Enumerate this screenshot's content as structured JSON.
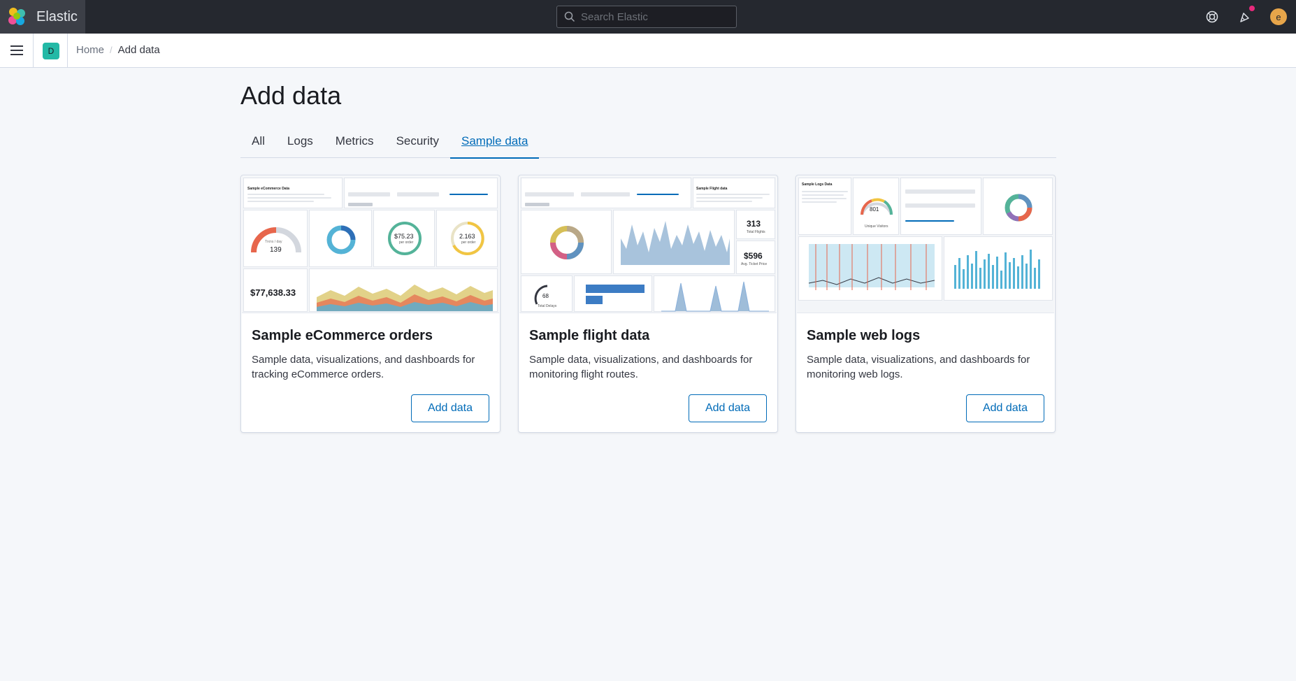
{
  "header": {
    "brand": "Elastic",
    "search_placeholder": "Search Elastic",
    "avatar_initial": "e",
    "icons": [
      "elastic-logo-icon",
      "search-icon",
      "help-icon",
      "newsfeed-icon"
    ]
  },
  "subheader": {
    "space_initial": "D",
    "breadcrumbs": [
      "Home",
      "Add data"
    ]
  },
  "main": {
    "title": "Add data",
    "tabs": [
      "All",
      "Logs",
      "Metrics",
      "Security",
      "Sample data"
    ],
    "active_tab": "Sample data",
    "cards": [
      {
        "title": "Sample eCommerce orders",
        "description": "Sample data, visualizations, and dashboards for tracking eCommerce orders.",
        "button": "Add data",
        "thumb": {
          "markdown_title": "Sample eCommerce Data",
          "gauge_label": "Trxns / day",
          "gauge_value": "139",
          "avg_price": "$75.23",
          "avg_price_sub": "per order",
          "avg_items": "2.163",
          "avg_items_sub": "per order",
          "total_revenue": "$77,638.33"
        }
      },
      {
        "title": "Sample flight data",
        "description": "Sample data, visualizations, and dashboards for monitoring flight routes.",
        "button": "Add data",
        "thumb": {
          "markdown_title": "Sample Flight data",
          "total_flights": "313",
          "total_flights_label": "Total Flights",
          "avg_ticket": "$596",
          "avg_ticket_label": "Avg. Ticket Price",
          "delays": "68",
          "delays_label": "Total Delays"
        }
      },
      {
        "title": "Sample web logs",
        "description": "Sample data, visualizations, and dashboards for monitoring web logs.",
        "button": "Add data",
        "thumb": {
          "markdown_title": "Sample Logs Data",
          "visitors": "801",
          "visitors_label": "Unique Visitors"
        }
      }
    ]
  },
  "colors": {
    "header_bg": "#25282f",
    "accent": "#006bb8",
    "space_badge": "#23b9a6",
    "avatar": "#e7a54a",
    "notification": "#e72a7c"
  }
}
